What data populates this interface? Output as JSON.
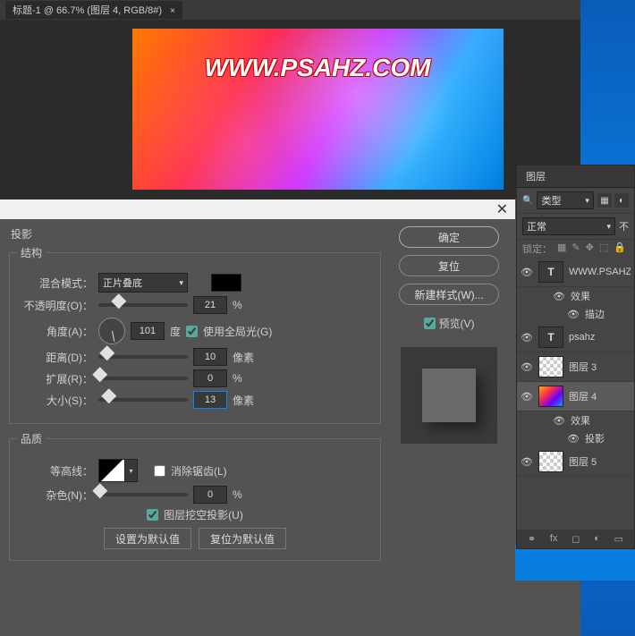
{
  "tab": {
    "title": "标题-1 @ 66.7% (图层 4, RGB/8#)"
  },
  "watermark": "WWW.PSAHZ.COM",
  "dialog": {
    "section": "投影",
    "structure_legend": "结构",
    "blend_label": "混合模式：",
    "blend_value": "正片叠底",
    "opacity_label": "不透明度(O)：",
    "opacity_value": "21",
    "opacity_unit": "%",
    "angle_label": "角度(A)：",
    "angle_value": "101",
    "angle_unit": "度",
    "global_light": "使用全局光(G)",
    "distance_label": "距离(D)：",
    "distance_value": "10",
    "distance_unit": "像素",
    "spread_label": "扩展(R)：",
    "spread_value": "0",
    "spread_unit": "%",
    "size_label": "大小(S)：",
    "size_value": "13",
    "size_unit": "像素",
    "quality_legend": "品质",
    "contour_label": "等高线：",
    "antialias": "消除锯齿(L)",
    "noise_label": "杂色(N)：",
    "noise_value": "0",
    "noise_unit": "%",
    "knockout": "图层挖空投影(U)",
    "set_default": "设置为默认值",
    "reset_default": "复位为默认值",
    "ok": "确定",
    "reset": "复位",
    "new_style": "新建样式(W)...",
    "preview": "预览(V)"
  },
  "layers": {
    "title": "图层",
    "kind": "类型",
    "mode": "正常",
    "opacity_label": "不",
    "lock_label": "锁定：",
    "items": [
      {
        "type": "T",
        "name": "WWW.PSAHZ"
      },
      {
        "type": "fx",
        "name": "效果",
        "sub": true
      },
      {
        "type": "fx2",
        "name": "描边",
        "sub": true,
        "indent": true
      },
      {
        "type": "T",
        "name": "psahz"
      },
      {
        "type": "trans",
        "name": "图层 3"
      },
      {
        "type": "grad",
        "name": "图层 4",
        "selected": true
      },
      {
        "type": "fx",
        "name": "效果",
        "sub": true
      },
      {
        "type": "fx2",
        "name": "投影",
        "sub": true,
        "indent": true
      },
      {
        "type": "trans",
        "name": "图层 5"
      }
    ]
  }
}
